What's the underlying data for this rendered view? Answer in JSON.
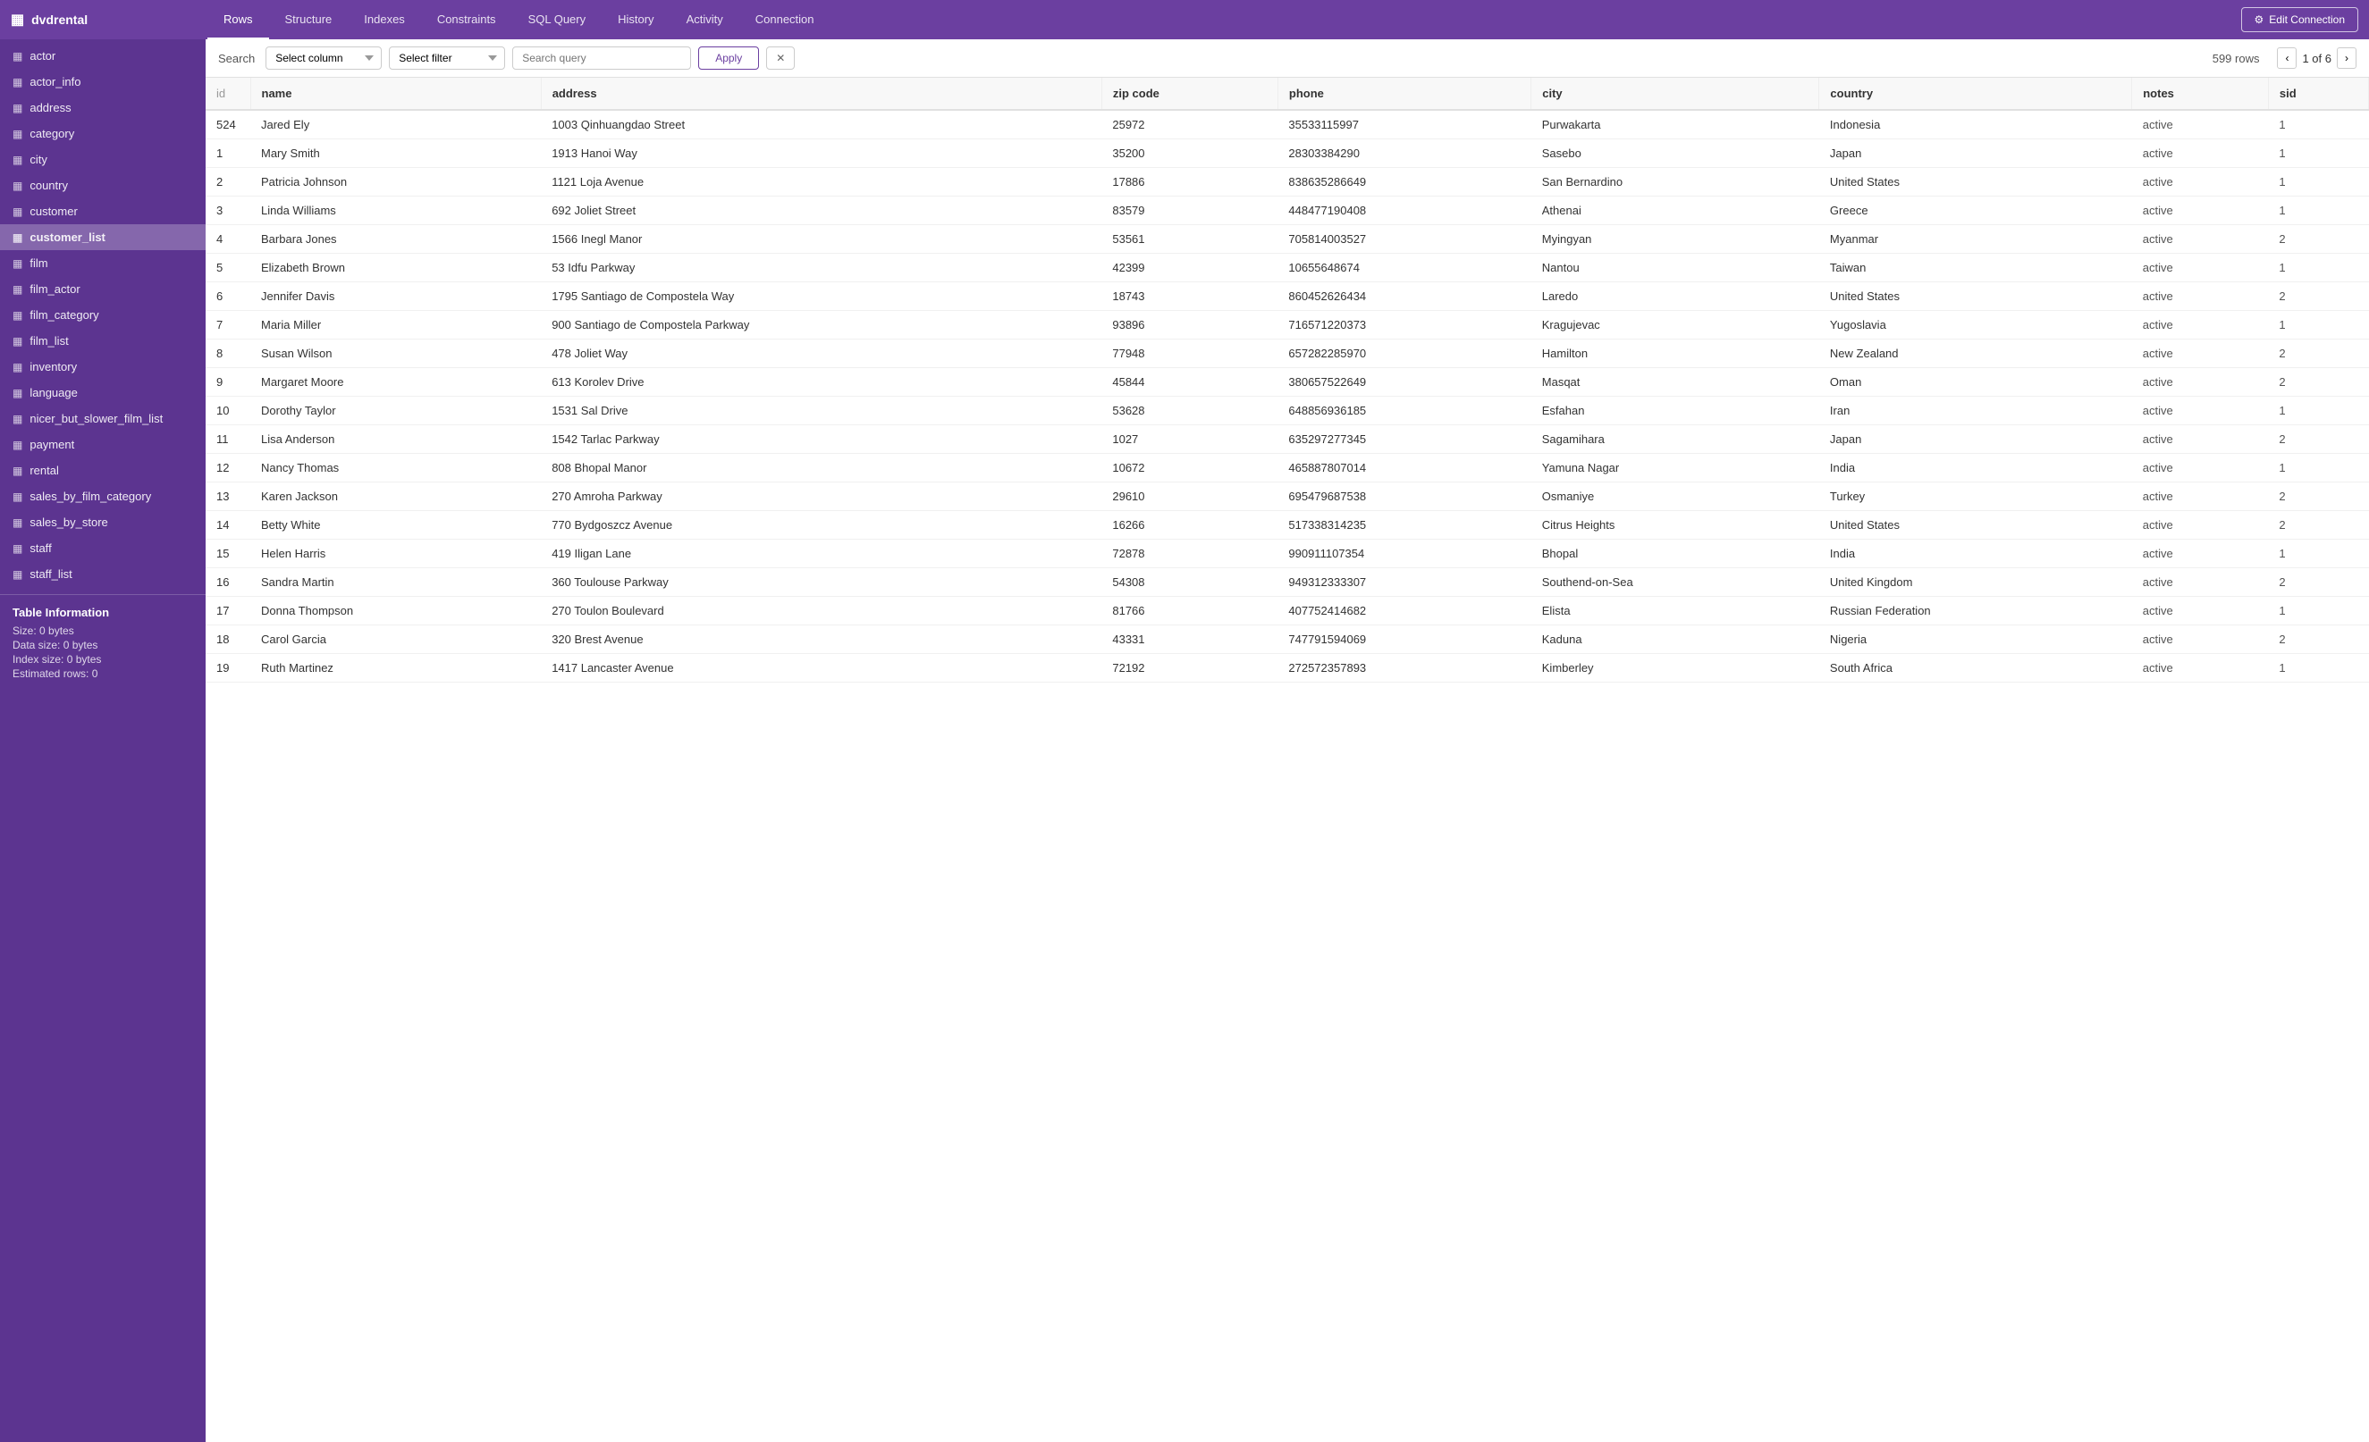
{
  "app": {
    "db_name": "dvdrental",
    "grid_icon": "▦"
  },
  "nav_tabs": [
    {
      "id": "rows",
      "label": "Rows",
      "active": true
    },
    {
      "id": "structure",
      "label": "Structure",
      "active": false
    },
    {
      "id": "indexes",
      "label": "Indexes",
      "active": false
    },
    {
      "id": "constraints",
      "label": "Constraints",
      "active": false
    },
    {
      "id": "sql_query",
      "label": "SQL Query",
      "active": false
    },
    {
      "id": "history",
      "label": "History",
      "active": false
    },
    {
      "id": "activity",
      "label": "Activity",
      "active": false
    },
    {
      "id": "connection",
      "label": "Connection",
      "active": false
    }
  ],
  "edit_connection_label": "Edit Connection",
  "sidebar_items": [
    {
      "name": "actor"
    },
    {
      "name": "actor_info"
    },
    {
      "name": "address"
    },
    {
      "name": "category"
    },
    {
      "name": "city"
    },
    {
      "name": "country"
    },
    {
      "name": "customer"
    },
    {
      "name": "customer_list",
      "active": true
    },
    {
      "name": "film"
    },
    {
      "name": "film_actor"
    },
    {
      "name": "film_category"
    },
    {
      "name": "film_list"
    },
    {
      "name": "inventory"
    },
    {
      "name": "language"
    },
    {
      "name": "nicer_but_slower_film_list"
    },
    {
      "name": "payment"
    },
    {
      "name": "rental"
    },
    {
      "name": "sales_by_film_category"
    },
    {
      "name": "sales_by_store"
    },
    {
      "name": "staff"
    },
    {
      "name": "staff_list"
    }
  ],
  "table_info": {
    "title": "Table Information",
    "size_label": "Size: 0 bytes",
    "data_size_label": "Data size: 0 bytes",
    "index_size_label": "Index size: 0 bytes",
    "estimated_rows_label": "Estimated rows: 0"
  },
  "search": {
    "label": "Search",
    "col_placeholder": "Select column",
    "filter_placeholder": "Select filter",
    "query_placeholder": "Search query",
    "apply_label": "Apply",
    "clear_icon": "✕"
  },
  "pagination": {
    "rows_count": "599 rows",
    "current_page": "1 of 6",
    "prev_icon": "‹",
    "next_icon": "›"
  },
  "columns": [
    "id",
    "name",
    "address",
    "zip code",
    "phone",
    "city",
    "country",
    "notes",
    "sid"
  ],
  "rows": [
    {
      "id": 524,
      "name": "Jared Ely",
      "address": "1003 Qinhuangdao Street",
      "zip": "25972",
      "phone": "35533115997",
      "city": "Purwakarta",
      "country": "Indonesia",
      "notes": "active",
      "sid": 1
    },
    {
      "id": 1,
      "name": "Mary Smith",
      "address": "1913 Hanoi Way",
      "zip": "35200",
      "phone": "28303384290",
      "city": "Sasebo",
      "country": "Japan",
      "notes": "active",
      "sid": 1
    },
    {
      "id": 2,
      "name": "Patricia Johnson",
      "address": "1121 Loja Avenue",
      "zip": "17886",
      "phone": "838635286649",
      "city": "San Bernardino",
      "country": "United States",
      "notes": "active",
      "sid": 1
    },
    {
      "id": 3,
      "name": "Linda Williams",
      "address": "692 Joliet Street",
      "zip": "83579",
      "phone": "448477190408",
      "city": "Athenai",
      "country": "Greece",
      "notes": "active",
      "sid": 1
    },
    {
      "id": 4,
      "name": "Barbara Jones",
      "address": "1566 Inegl Manor",
      "zip": "53561",
      "phone": "705814003527",
      "city": "Myingyan",
      "country": "Myanmar",
      "notes": "active",
      "sid": 2
    },
    {
      "id": 5,
      "name": "Elizabeth Brown",
      "address": "53 Idfu Parkway",
      "zip": "42399",
      "phone": "10655648674",
      "city": "Nantou",
      "country": "Taiwan",
      "notes": "active",
      "sid": 1
    },
    {
      "id": 6,
      "name": "Jennifer Davis",
      "address": "1795 Santiago de Compostela Way",
      "zip": "18743",
      "phone": "860452626434",
      "city": "Laredo",
      "country": "United States",
      "notes": "active",
      "sid": 2
    },
    {
      "id": 7,
      "name": "Maria Miller",
      "address": "900 Santiago de Compostela Parkway",
      "zip": "93896",
      "phone": "716571220373",
      "city": "Kragujevac",
      "country": "Yugoslavia",
      "notes": "active",
      "sid": 1
    },
    {
      "id": 8,
      "name": "Susan Wilson",
      "address": "478 Joliet Way",
      "zip": "77948",
      "phone": "657282285970",
      "city": "Hamilton",
      "country": "New Zealand",
      "notes": "active",
      "sid": 2
    },
    {
      "id": 9,
      "name": "Margaret Moore",
      "address": "613 Korolev Drive",
      "zip": "45844",
      "phone": "380657522649",
      "city": "Masqat",
      "country": "Oman",
      "notes": "active",
      "sid": 2
    },
    {
      "id": 10,
      "name": "Dorothy Taylor",
      "address": "1531 Sal Drive",
      "zip": "53628",
      "phone": "648856936185",
      "city": "Esfahan",
      "country": "Iran",
      "notes": "active",
      "sid": 1
    },
    {
      "id": 11,
      "name": "Lisa Anderson",
      "address": "1542 Tarlac Parkway",
      "zip": "1027",
      "phone": "635297277345",
      "city": "Sagamihara",
      "country": "Japan",
      "notes": "active",
      "sid": 2
    },
    {
      "id": 12,
      "name": "Nancy Thomas",
      "address": "808 Bhopal Manor",
      "zip": "10672",
      "phone": "465887807014",
      "city": "Yamuna Nagar",
      "country": "India",
      "notes": "active",
      "sid": 1
    },
    {
      "id": 13,
      "name": "Karen Jackson",
      "address": "270 Amroha Parkway",
      "zip": "29610",
      "phone": "695479687538",
      "city": "Osmaniye",
      "country": "Turkey",
      "notes": "active",
      "sid": 2
    },
    {
      "id": 14,
      "name": "Betty White",
      "address": "770 Bydgoszcz Avenue",
      "zip": "16266",
      "phone": "517338314235",
      "city": "Citrus Heights",
      "country": "United States",
      "notes": "active",
      "sid": 2
    },
    {
      "id": 15,
      "name": "Helen Harris",
      "address": "419 Iligan Lane",
      "zip": "72878",
      "phone": "990911107354",
      "city": "Bhopal",
      "country": "India",
      "notes": "active",
      "sid": 1
    },
    {
      "id": 16,
      "name": "Sandra Martin",
      "address": "360 Toulouse Parkway",
      "zip": "54308",
      "phone": "949312333307",
      "city": "Southend-on-Sea",
      "country": "United Kingdom",
      "notes": "active",
      "sid": 2
    },
    {
      "id": 17,
      "name": "Donna Thompson",
      "address": "270 Toulon Boulevard",
      "zip": "81766",
      "phone": "407752414682",
      "city": "Elista",
      "country": "Russian Federation",
      "notes": "active",
      "sid": 1
    },
    {
      "id": 18,
      "name": "Carol Garcia",
      "address": "320 Brest Avenue",
      "zip": "43331",
      "phone": "747791594069",
      "city": "Kaduna",
      "country": "Nigeria",
      "notes": "active",
      "sid": 2
    },
    {
      "id": 19,
      "name": "Ruth Martinez",
      "address": "1417 Lancaster Avenue",
      "zip": "72192",
      "phone": "272572357893",
      "city": "Kimberley",
      "country": "South Africa",
      "notes": "active",
      "sid": 1
    }
  ]
}
